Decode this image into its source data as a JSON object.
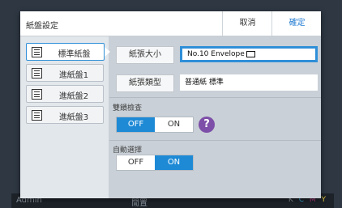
{
  "dialog": {
    "title": "紙盤設定",
    "cancel_label": "取消",
    "ok_label": "確定"
  },
  "sidebar": {
    "items": [
      {
        "label": "標準紙盤",
        "icon": "tray-icon",
        "active": true
      },
      {
        "label": "進紙盤1",
        "icon": "tray-icon",
        "active": false
      },
      {
        "label": "進紙盤2",
        "icon": "tray-icon",
        "active": false
      },
      {
        "label": "進紙盤3",
        "icon": "tray-icon",
        "active": false
      }
    ]
  },
  "paper_size": {
    "label": "紙張大小",
    "value": "No.10 Envelope",
    "icon": "envelope-icon"
  },
  "paper_type": {
    "label": "紙張類型",
    "value": "普通紙 標準"
  },
  "double_feed_check": {
    "label": "雙饋檢查",
    "off_label": "OFF",
    "on_label": "ON",
    "selected": "OFF",
    "help_label": "?"
  },
  "auto_select": {
    "label": "自動選擇",
    "off_label": "OFF",
    "on_label": "ON",
    "selected": "ON"
  },
  "statusbar": {
    "user": "Admin",
    "mode": "閒置",
    "toner": [
      "K",
      "C",
      "M",
      "Y"
    ]
  },
  "colors": {
    "accent": "#1e8ad6",
    "focus_border": "#2f8fd8",
    "help": "#7d4fa8",
    "sidebar_bg": "#e2e7ec",
    "panel_bg": "#c9d0d7"
  }
}
